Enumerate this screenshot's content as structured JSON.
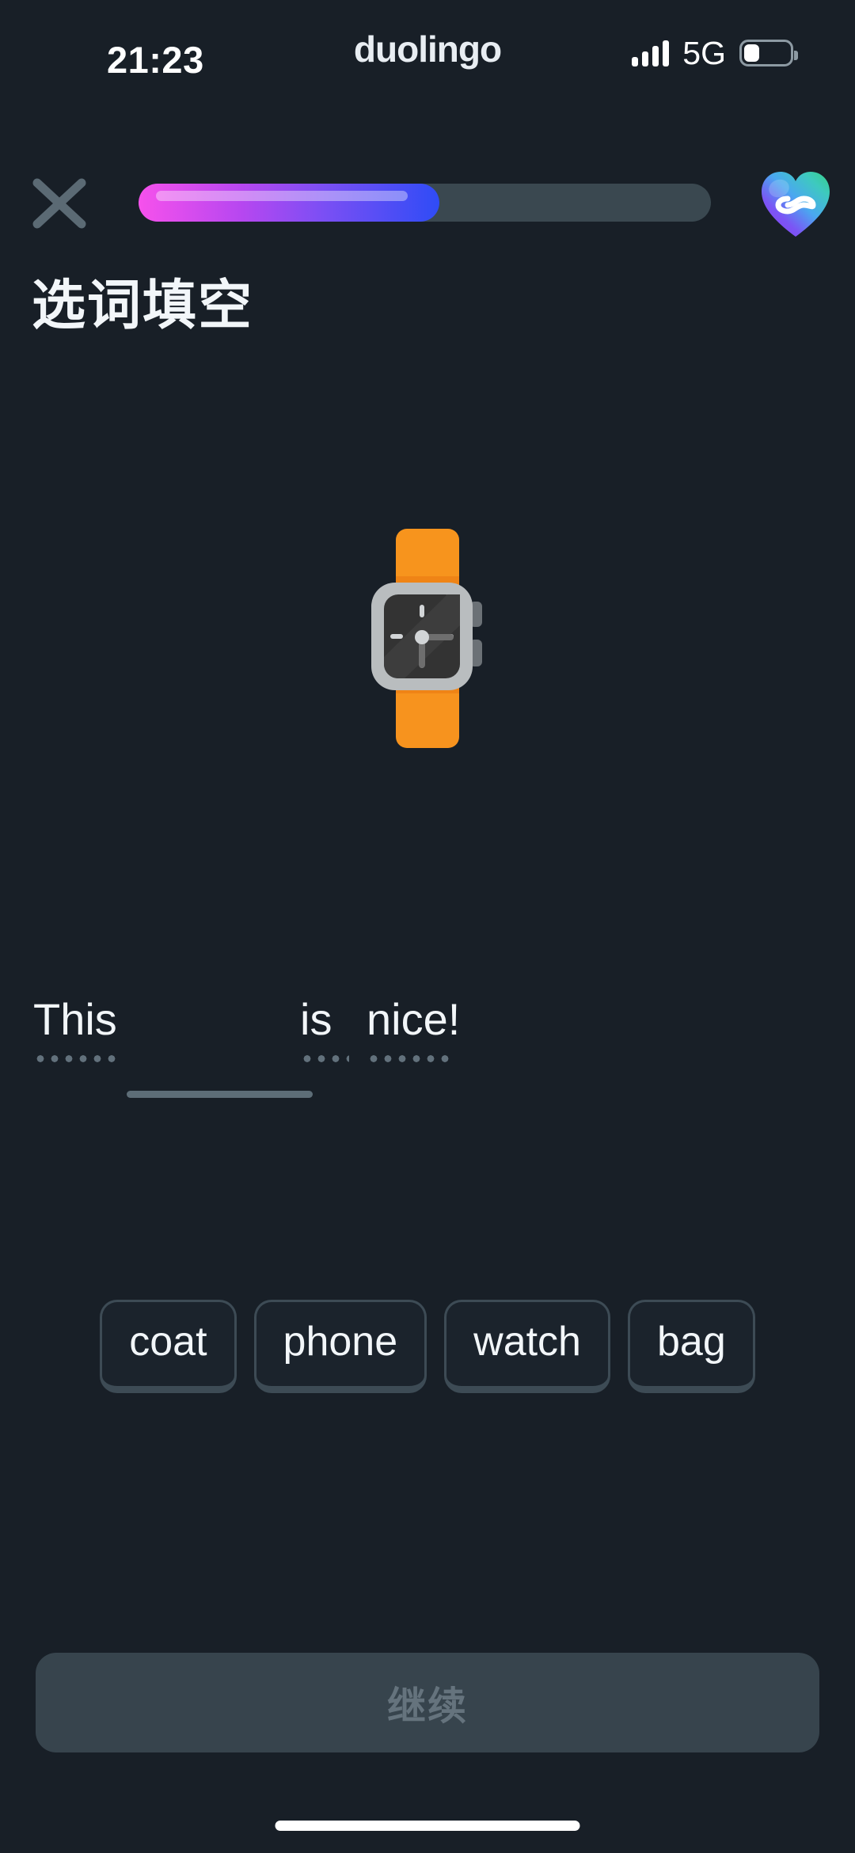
{
  "theme": {
    "background": "#181f27",
    "text_primary": "#f2f6f9",
    "text_muted": "#65737d",
    "progress_track": "#3a4850",
    "progress_start": "#f651ec",
    "progress_end": "#2f4cf6",
    "chip_border": "#3d4b55",
    "chip_bg": "#1b232c",
    "accent_orange": "#f7931e"
  },
  "status_bar": {
    "time": "21:23",
    "brand": "duolingo",
    "network": "5G",
    "signal_bars": 4,
    "battery_level_percent": 30,
    "icons": {
      "signal": "cellular-signal-icon",
      "battery": "battery-icon"
    }
  },
  "header": {
    "close_icon": "close-icon",
    "progress_percent": 52.5,
    "hearts_icon": "heart-infinity-icon",
    "hearts_value": "∞"
  },
  "lesson": {
    "title": "选词填空"
  },
  "illustration": {
    "name": "wristwatch-illustration",
    "alt": "watch"
  },
  "exercise": {
    "prompt_parts": [
      {
        "text": "This",
        "has_hint": true
      },
      {
        "text": "",
        "is_blank": true
      },
      {
        "text": "is",
        "has_hint": true
      },
      {
        "text": "nice!",
        "has_hint": true
      }
    ],
    "full_sentence": "This ___ is nice!",
    "blank_filled": false
  },
  "word_bank": {
    "options": [
      {
        "label": "coat",
        "selected": false
      },
      {
        "label": "phone",
        "selected": false
      },
      {
        "label": "watch",
        "selected": false
      },
      {
        "label": "bag",
        "selected": false
      }
    ]
  },
  "footer": {
    "continue_label": "继续",
    "continue_enabled": false
  }
}
